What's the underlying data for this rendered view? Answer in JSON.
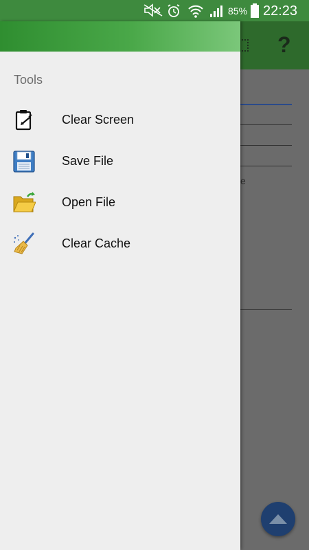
{
  "status_bar": {
    "battery_percent": "85%",
    "time": "22:23",
    "icons": [
      "mute-icon",
      "alarm-icon",
      "wifi-icon",
      "signal-icon",
      "battery-icon"
    ]
  },
  "background_app": {
    "toolbar_color": "#2e6a2c",
    "help_glyph": "?",
    "visible_fragment": "e"
  },
  "drawer": {
    "header_color": "#3fa03f",
    "section_title": "Tools",
    "items": [
      {
        "label": "Clear Screen",
        "icon": "clipboard-icon"
      },
      {
        "label": "Save File",
        "icon": "floppy-disk-icon"
      },
      {
        "label": "Open File",
        "icon": "open-folder-icon"
      },
      {
        "label": "Clear Cache",
        "icon": "broom-icon"
      }
    ]
  },
  "fab": {
    "icon": "chevron-up-icon",
    "color": "#1f3f6f"
  }
}
